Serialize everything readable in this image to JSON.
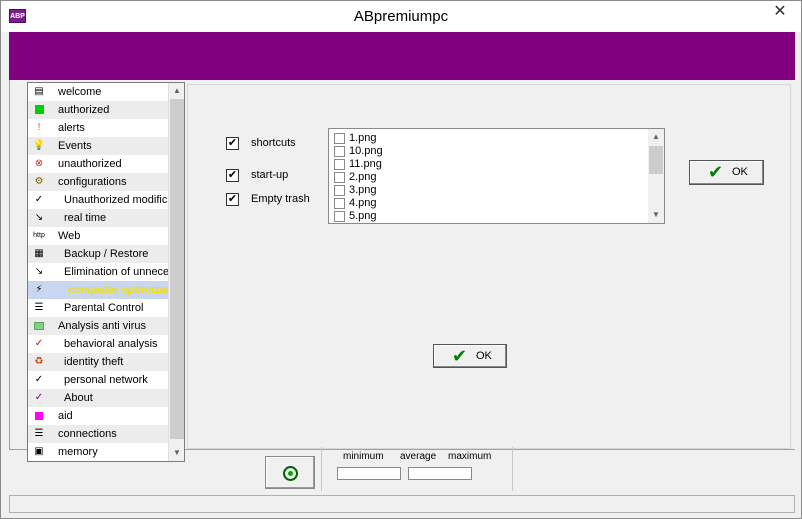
{
  "window": {
    "title": "ABpremiumpc",
    "app_icon_text": "ABP",
    "close_glyph": "✕"
  },
  "sidebar": {
    "items": [
      {
        "label": "welcome",
        "icon": "window-icon",
        "glyph": "▤"
      },
      {
        "label": "authorized",
        "icon": "green-square-icon",
        "glyph": ""
      },
      {
        "label": "alerts",
        "icon": "alert-person-icon",
        "glyph": "!"
      },
      {
        "label": "Events",
        "icon": "lightbulb-icon",
        "glyph": "💡"
      },
      {
        "label": "unauthorized",
        "icon": "forbidden-icon",
        "glyph": "⊗"
      },
      {
        "label": "configurations",
        "icon": "config-icon",
        "glyph": "⚙"
      },
      {
        "label": "Unauthorized modifications",
        "icon": "checkmark-icon",
        "glyph": "✓"
      },
      {
        "label": "real time",
        "icon": "realtime-icon",
        "glyph": "↘"
      },
      {
        "label": "Web",
        "icon": "web-icon",
        "glyph": "http"
      },
      {
        "label": "Backup / Restore",
        "icon": "backup-icon",
        "glyph": "▦"
      },
      {
        "label": "Elimination of unnecessary",
        "icon": "elimination-icon",
        "glyph": "↘"
      },
      {
        "label": "computer optimization",
        "icon": "optimize-icon",
        "glyph": "⚡"
      },
      {
        "label": "Parental Control",
        "icon": "list-icon",
        "glyph": "☰"
      },
      {
        "label": "Analysis anti virus",
        "icon": "green-rect-icon",
        "glyph": ""
      },
      {
        "label": "behavioral analysis",
        "icon": "red-check-icon",
        "glyph": "✓"
      },
      {
        "label": "identity theft",
        "icon": "recycle-icon",
        "glyph": "♻"
      },
      {
        "label": "personal network",
        "icon": "network-icon",
        "glyph": "✓"
      },
      {
        "label": "About",
        "icon": "about-check-icon",
        "glyph": "✓"
      },
      {
        "label": "aid",
        "icon": "magenta-square-icon",
        "glyph": ""
      },
      {
        "label": "connections",
        "icon": "connections-icon",
        "glyph": "☰"
      },
      {
        "label": "memory",
        "icon": "memory-icon",
        "glyph": "▣"
      }
    ],
    "scroll_up_glyph": "▲",
    "scroll_down_glyph": "▼"
  },
  "options": {
    "shortcuts": {
      "label": "shortcuts",
      "checked": "✔"
    },
    "startup": {
      "label": "start-up",
      "checked": "✔"
    },
    "empty_trash": {
      "label": "Empty trash",
      "checked": "✔"
    }
  },
  "file_list": {
    "items": [
      "1.png",
      "10.png",
      "11.png",
      "2.png",
      "3.png",
      "4.png",
      "5.png"
    ],
    "scroll_up_glyph": "▲",
    "scroll_down_glyph": "▼"
  },
  "buttons": {
    "ok_top": {
      "label": "OK",
      "glyph": "✔"
    },
    "ok_center": {
      "label": "OK",
      "glyph": "✔"
    }
  },
  "stats": {
    "minimum": "minimum",
    "average": "average",
    "maximum": "maximum"
  },
  "colors": {
    "header": "#800080",
    "selected_text": "#f4e000",
    "ok_check": "#008000"
  }
}
